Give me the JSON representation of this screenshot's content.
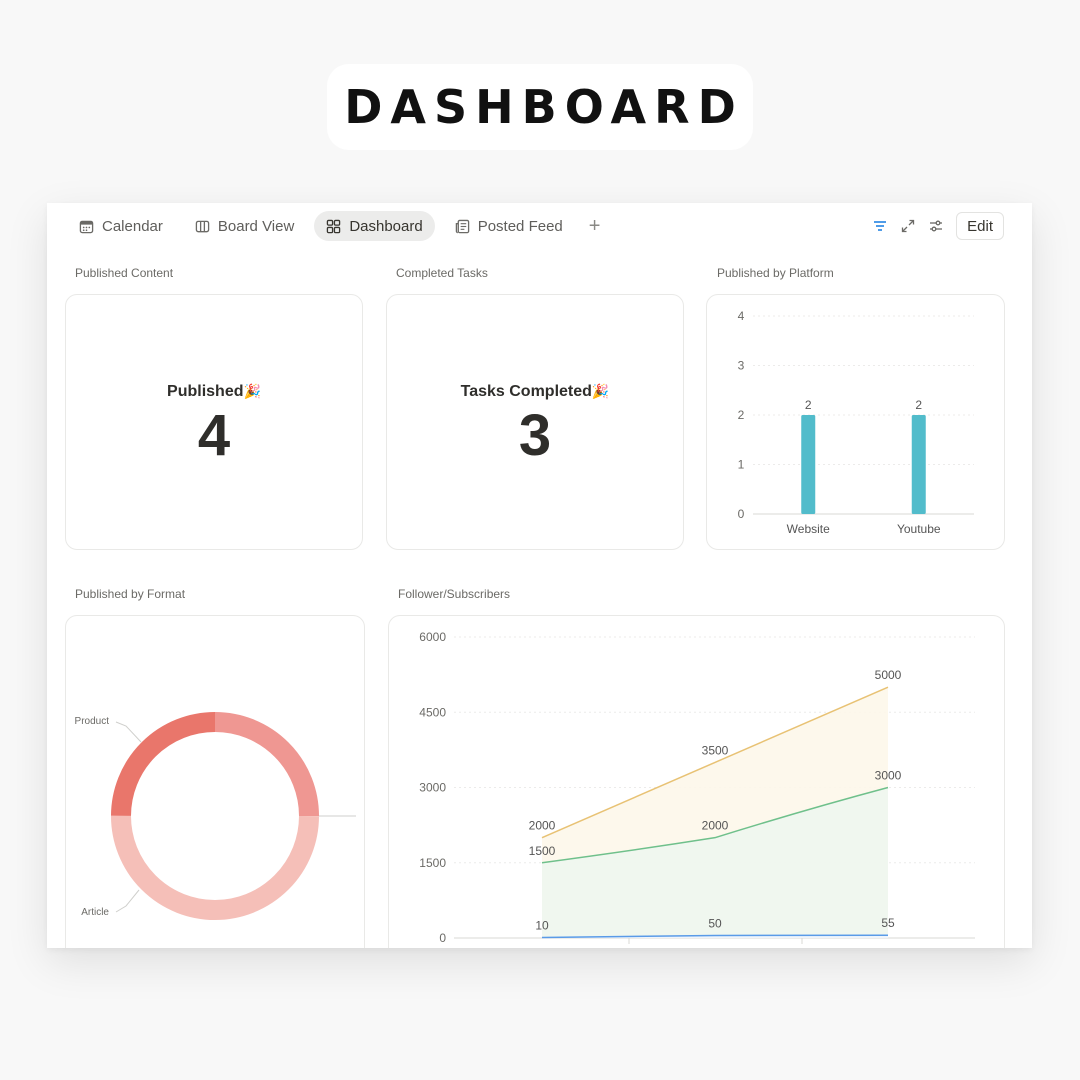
{
  "page": {
    "title": "DASHBOARD"
  },
  "tabs": [
    {
      "label": "Calendar",
      "icon": "calendar-icon",
      "active": false
    },
    {
      "label": "Board View",
      "icon": "columns-icon",
      "active": false
    },
    {
      "label": "Dashboard",
      "icon": "grid-icon",
      "active": true
    },
    {
      "label": "Posted Feed",
      "icon": "feed-icon",
      "active": false
    }
  ],
  "toolbar": {
    "add_icon": "plus-icon",
    "filter_icon": "filter-icon",
    "expand_icon": "expand-icon",
    "settings_icon": "sliders-icon",
    "edit_label": "Edit",
    "accent_color": "#2383e2"
  },
  "widgets": {
    "published_content": {
      "label": "Published Content",
      "title": "Published",
      "emoji": "🎉",
      "value": "4"
    },
    "completed_tasks": {
      "label": "Completed Tasks",
      "title": "Tasks Completed",
      "emoji": "🎉",
      "value": "3"
    },
    "published_by_platform": {
      "label": "Published by Platform"
    },
    "published_by_format": {
      "label": "Published by Format"
    },
    "followers": {
      "label": "Follower/Subscribers"
    }
  },
  "chart_data": [
    {
      "type": "bar",
      "categories": [
        "Website",
        "Youtube"
      ],
      "values": [
        2,
        2
      ],
      "ylim": [
        0,
        4
      ],
      "yticks": [
        0,
        1,
        2,
        3,
        4
      ],
      "grid": true,
      "color": "#52bccb"
    },
    {
      "type": "pie",
      "donut": true,
      "labels": [
        "Product",
        "Article"
      ],
      "slices": [
        {
          "label": "Product",
          "value": 0.25,
          "color": "#ef9792"
        },
        {
          "label": "",
          "value": 0.5,
          "color": "#f5bfb8"
        },
        {
          "label": "Article",
          "value": 0.25,
          "color": "#e9766b"
        }
      ]
    },
    {
      "type": "area",
      "ylim": [
        0,
        6000
      ],
      "yticks": [
        0,
        1500,
        3000,
        4500,
        6000
      ],
      "grid": true,
      "series": [
        {
          "values": [
            2000,
            3500,
            5000
          ],
          "color": "#e8c274",
          "fill": "#fdf7ea"
        },
        {
          "values": [
            1500,
            2000,
            3000
          ],
          "color": "#6fc08b",
          "fill": "#eef6ef"
        },
        {
          "values": [
            10,
            50,
            55
          ],
          "color": "#5a9be8",
          "fill": "#eef4fc"
        }
      ]
    }
  ]
}
